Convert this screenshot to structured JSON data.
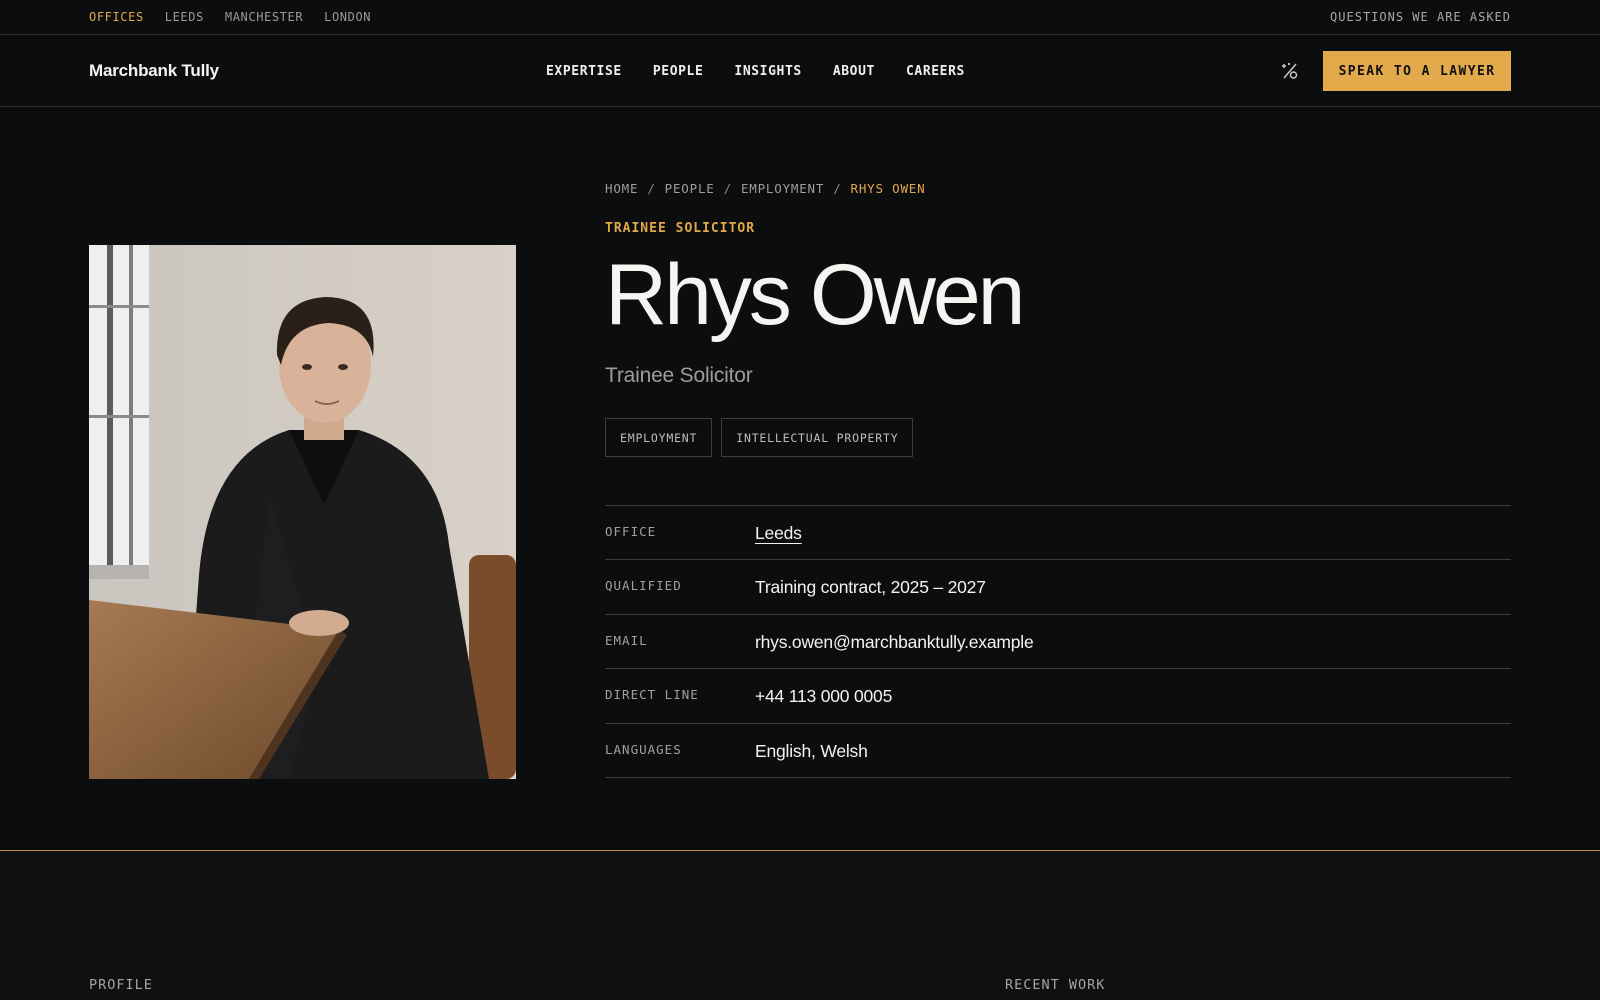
{
  "utility_bar": {
    "offices_label": "OFFICES",
    "offices": [
      "LEEDS",
      "MANCHESTER",
      "LONDON"
    ],
    "faq_link": "QUESTIONS WE ARE ASKED",
    "accent_color": "#e2a84a"
  },
  "header": {
    "logo": "Marchbank Tully",
    "nav": [
      "EXPERTISE",
      "PEOPLE",
      "INSIGHTS",
      "ABOUT",
      "CAREERS"
    ],
    "theme_icon": "theme-toggle-icon",
    "cta_label": "SPEAK TO A LAWYER",
    "cta_color": "#e3aa4c"
  },
  "breadcrumb": {
    "items": [
      "HOME",
      "PEOPLE",
      "EMPLOYMENT"
    ],
    "current": "RHYS OWEN",
    "separator": "/"
  },
  "profile": {
    "eyebrow": "TRAINEE SOLICITOR",
    "name": "Rhys Owen",
    "role": "Trainee Solicitor",
    "tags": [
      "EMPLOYMENT",
      "INTELLECTUAL PROPERTY"
    ],
    "details": [
      {
        "label": "OFFICE",
        "value": "Leeds"
      },
      {
        "label": "QUALIFIED",
        "value": "Training contract, 2025 – 2027"
      },
      {
        "label": "EMAIL",
        "value": "rhys.owen@marchbanktully.example"
      },
      {
        "label": "DIRECT LINE",
        "value": "+44 113 000 0005"
      },
      {
        "label": "LANGUAGES",
        "value": "English, Welsh"
      }
    ]
  },
  "lower": {
    "profile_label": "PROFILE",
    "recent_work_label": "RECENT WORK"
  }
}
